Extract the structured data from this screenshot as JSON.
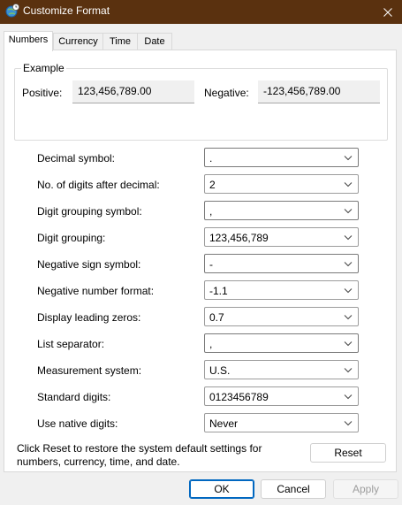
{
  "window": {
    "title": "Customize Format"
  },
  "tabs": [
    {
      "label": "Numbers"
    },
    {
      "label": "Currency"
    },
    {
      "label": "Time"
    },
    {
      "label": "Date"
    }
  ],
  "example": {
    "group_label": "Example",
    "positive_label": "Positive:",
    "positive_value": "123,456,789.00",
    "negative_label": "Negative:",
    "negative_value": "-123,456,789.00"
  },
  "settings": [
    {
      "label": "Decimal symbol:",
      "value": "."
    },
    {
      "label": "No. of digits after decimal:",
      "value": "2"
    },
    {
      "label": "Digit grouping symbol:",
      "value": ","
    },
    {
      "label": "Digit grouping:",
      "value": "123,456,789"
    },
    {
      "label": "Negative sign symbol:",
      "value": "-"
    },
    {
      "label": "Negative number format:",
      "value": "-1.1"
    },
    {
      "label": "Display leading zeros:",
      "value": "0.7"
    },
    {
      "label": "List separator:",
      "value": ","
    },
    {
      "label": "Measurement system:",
      "value": "U.S."
    },
    {
      "label": "Standard digits:",
      "value": "0123456789"
    },
    {
      "label": "Use native digits:",
      "value": "Never"
    }
  ],
  "footer": {
    "reset_note": "Click Reset to restore the system default settings for numbers, currency, time, and date.",
    "reset_label": "Reset"
  },
  "buttons": {
    "ok": "OK",
    "cancel": "Cancel",
    "apply": "Apply"
  },
  "colors": {
    "titlebar": "#5a310f",
    "accent": "#0067c0"
  }
}
